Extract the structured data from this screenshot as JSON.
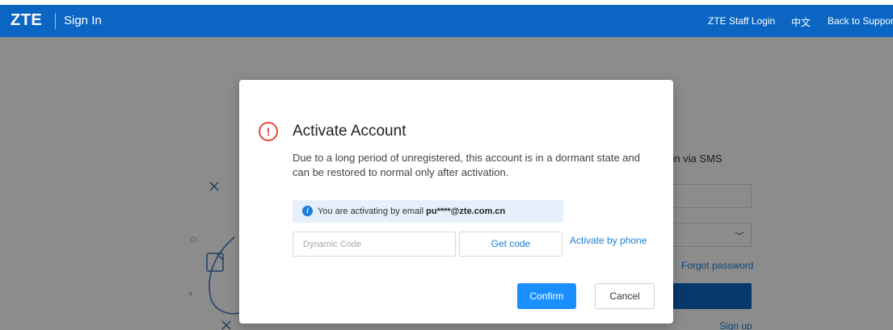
{
  "header": {
    "logo": "ZTE",
    "title": "Sign In",
    "nav": [
      "ZTE Staff Login",
      "中文",
      "Back to Support"
    ]
  },
  "background_form": {
    "sms_tab": "ogin via SMS",
    "forgot_password": "Forgot password",
    "sign_up": "Sign up"
  },
  "modal": {
    "title": "Activate Account",
    "description": "Due to a long period of unregistered, this account is in a dormant state and can be restored to normal only after activation.",
    "info_prefix": "You are activating by email ",
    "info_email": "pu****@zte.com.cn",
    "code_placeholder": "Dynamic Code",
    "get_code": "Get code",
    "activate_by_phone": "Activate by phone",
    "confirm": "Confirm",
    "cancel": "Cancel"
  },
  "colors": {
    "header_bg": "#0b66c3",
    "primary": "#1a8fff",
    "link": "#1a7fd6",
    "warning": "#e8463b",
    "info_bg": "#e6f0fa"
  },
  "icons": [
    "warning-circle-icon",
    "info-icon",
    "chevron-down-icon"
  ]
}
